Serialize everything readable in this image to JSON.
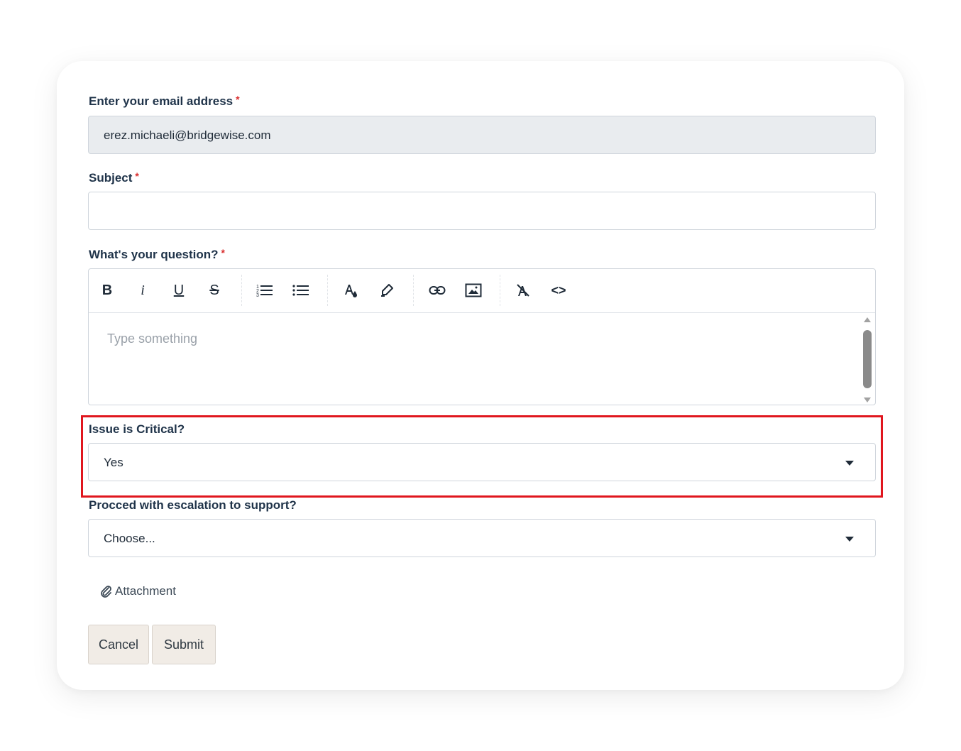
{
  "form": {
    "email": {
      "label": "Enter your email address",
      "required_mark": "*",
      "value": "erez.michaeli@bridgewise.com"
    },
    "subject": {
      "label": "Subject",
      "required_mark": "*",
      "value": ""
    },
    "question": {
      "label": "What's your question?",
      "required_mark": "*",
      "placeholder": "Type something",
      "toolbar": [
        "bold-icon",
        "italic-icon",
        "underline-icon",
        "strikethrough-icon",
        "ordered-list-icon",
        "bullet-list-icon",
        "text-color-icon",
        "highlight-icon",
        "link-icon",
        "image-icon",
        "clear-format-icon",
        "code-icon"
      ],
      "toolbar_glyphs": {
        "bold": "B",
        "italic": "i",
        "underline": "U",
        "strike": "S",
        "code": "<>"
      }
    },
    "critical": {
      "label": "Issue is Critical?",
      "value": "Yes"
    },
    "escalation": {
      "label": "Procced with escalation to support?",
      "value": "Choose..."
    },
    "attachment": {
      "label": "Attachment",
      "icon": "paperclip-icon"
    },
    "buttons": {
      "cancel": "Cancel",
      "submit": "Submit"
    }
  },
  "colors": {
    "highlight_border": "#e0161e",
    "required": "#d92d2d",
    "label": "#1f3349",
    "button_bg": "#f1ece6"
  }
}
